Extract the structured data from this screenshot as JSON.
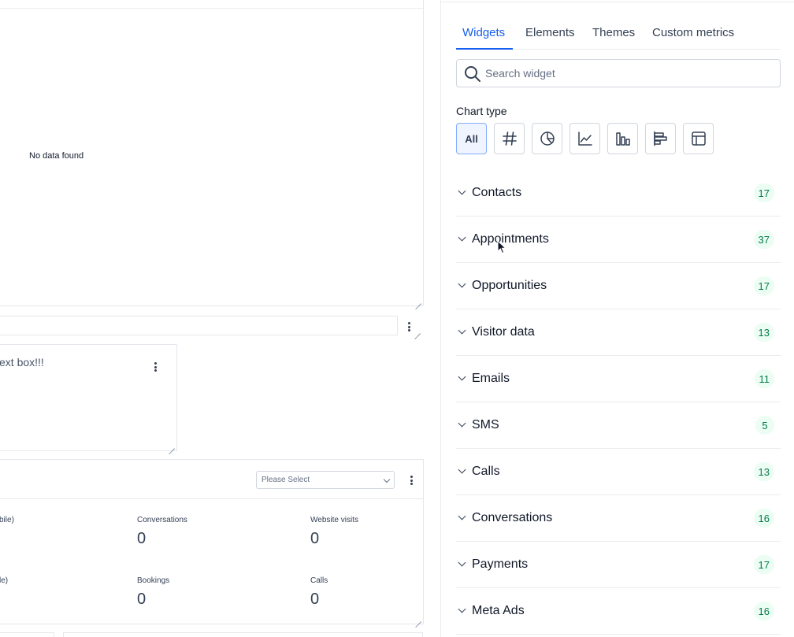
{
  "left": {
    "no_data": "No data found",
    "textbox_text": "ext box!!!",
    "select_placeholder": "Please Select",
    "stats": [
      {
        "label": "bile)",
        "value": ""
      },
      {
        "label": "Conversations",
        "value": "0"
      },
      {
        "label": "Website visits",
        "value": "0"
      },
      {
        "label": "le)",
        "value": ""
      },
      {
        "label": "Bookings",
        "value": "0"
      },
      {
        "label": "Calls",
        "value": "0"
      }
    ]
  },
  "panel": {
    "tabs": [
      {
        "label": "Widgets",
        "active": true
      },
      {
        "label": "Elements",
        "active": false
      },
      {
        "label": "Themes",
        "active": false
      },
      {
        "label": "Custom metrics",
        "active": false
      }
    ],
    "search_placeholder": "Search widget",
    "chart_type_label": "Chart type",
    "chart_types": [
      {
        "name": "all",
        "label": "All",
        "active": true
      },
      {
        "name": "number-icon",
        "active": false
      },
      {
        "name": "pie-chart-icon",
        "active": false
      },
      {
        "name": "line-chart-icon",
        "active": false
      },
      {
        "name": "bar-chart-icon",
        "active": false
      },
      {
        "name": "horizontal-bar-chart-icon",
        "active": false
      },
      {
        "name": "table-icon",
        "active": false
      }
    ],
    "categories": [
      {
        "label": "Contacts",
        "count": "17"
      },
      {
        "label": "Appointments",
        "count": "37"
      },
      {
        "label": "Opportunities",
        "count": "17"
      },
      {
        "label": "Visitor data",
        "count": "13"
      },
      {
        "label": "Emails",
        "count": "11"
      },
      {
        "label": "SMS",
        "count": "5"
      },
      {
        "label": "Calls",
        "count": "13"
      },
      {
        "label": "Conversations",
        "count": "16"
      },
      {
        "label": "Payments",
        "count": "17"
      },
      {
        "label": "Meta Ads",
        "count": "16"
      }
    ]
  },
  "colors": {
    "accent": "#155eef",
    "badge_bg": "#ecfdf3",
    "badge_text": "#027a48",
    "border": "#eaecf0"
  }
}
